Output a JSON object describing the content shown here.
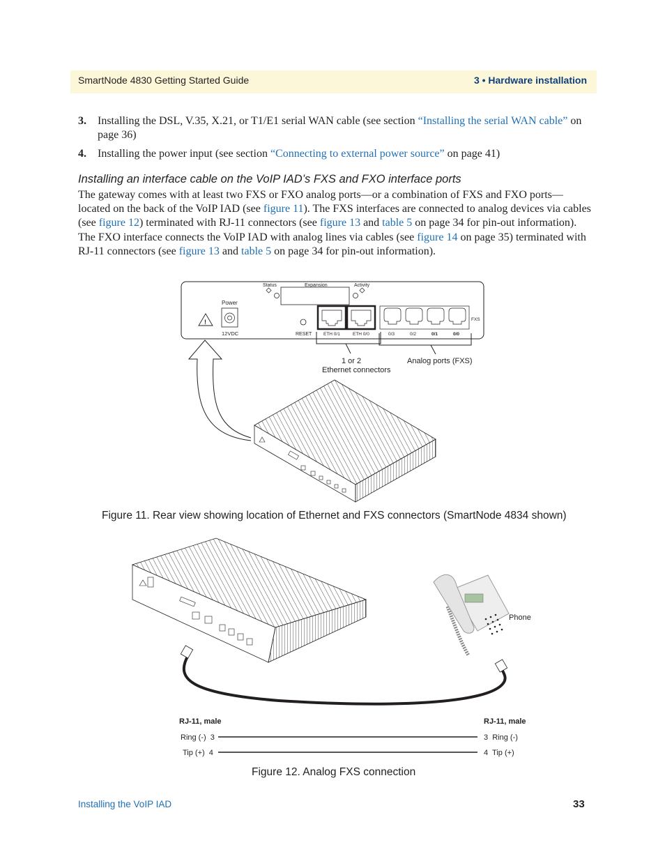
{
  "header": {
    "guide_title": "SmartNode 4830 Getting Started Guide",
    "chapter": "3 • Hardware installation"
  },
  "steps": [
    {
      "number": "3.",
      "text_before": "Installing the DSL, V.35, X.21, or T1/E1 serial WAN cable (see section ",
      "link": "“Installing the serial WAN cable”",
      "text_after": " on page 36)"
    },
    {
      "number": "4.",
      "text_before": "Installing the power input (see section ",
      "link": "“Connecting to external power source”",
      "text_after": " on page 41)"
    }
  ],
  "section": {
    "heading": "Installing an interface cable on the VoIP IAD’s FXS and FXO interface ports",
    "p1": "The gateway comes with at least two FXS or FXO analog ports—or a combination of FXS and FXO ports—located on the back of the VoIP IAD (see ",
    "link_fig11": "figure 11",
    "p2": "). The FXS interfaces are connected to analog devices via cables (see ",
    "link_fig12": "figure 12",
    "p3": ") terminated with RJ-11 connectors (see ",
    "link_fig13a": "figure 13",
    "p4": " and ",
    "link_table5a": "table 5",
    "p5": " on page 34 for pin-out information). The FXO interface connects the VoIP IAD with analog lines via cables (see ",
    "link_fig14": "figure 14",
    "p6": " on page 35) terminated with RJ-11 connectors (see ",
    "link_fig13b": "figure 13",
    "p7": " and ",
    "link_table5b": "table 5",
    "p8": " on page 34 for pin-out information)."
  },
  "figure11": {
    "caption": "Figure 11. Rear view showing location of Ethernet and FXS connectors (SmartNode 4834 shown)",
    "panel": {
      "status": "Status",
      "expansion": "Expansion",
      "activity": "Activity",
      "power": "Power",
      "power_rating": "12VDC",
      "reset": "RESET",
      "eth_ports": [
        "ETH 0/1",
        "ETH 0/0"
      ],
      "fxs_ports": [
        "0/3",
        "0/2",
        "0/1",
        "0/0"
      ],
      "fxs_label": "FXS",
      "warning_glyph": "!"
    },
    "callouts": {
      "ethernet_line1": "1 or 2",
      "ethernet_line2": "Ethernet connectors",
      "analog": "Analog ports (FXS)"
    }
  },
  "figure12": {
    "caption": "Figure 12. Analog FXS connection",
    "phone_label": "Phone",
    "left_connector": "RJ-11, male",
    "right_connector": "RJ-11, male",
    "pins": [
      {
        "left": "Ring (-)  3",
        "right": "3  Ring (-)"
      },
      {
        "left": "Tip (+)  4",
        "right": "4  Tip (+)"
      }
    ]
  },
  "footer": {
    "section": "Installing the VoIP IAD",
    "page_number": "33"
  }
}
